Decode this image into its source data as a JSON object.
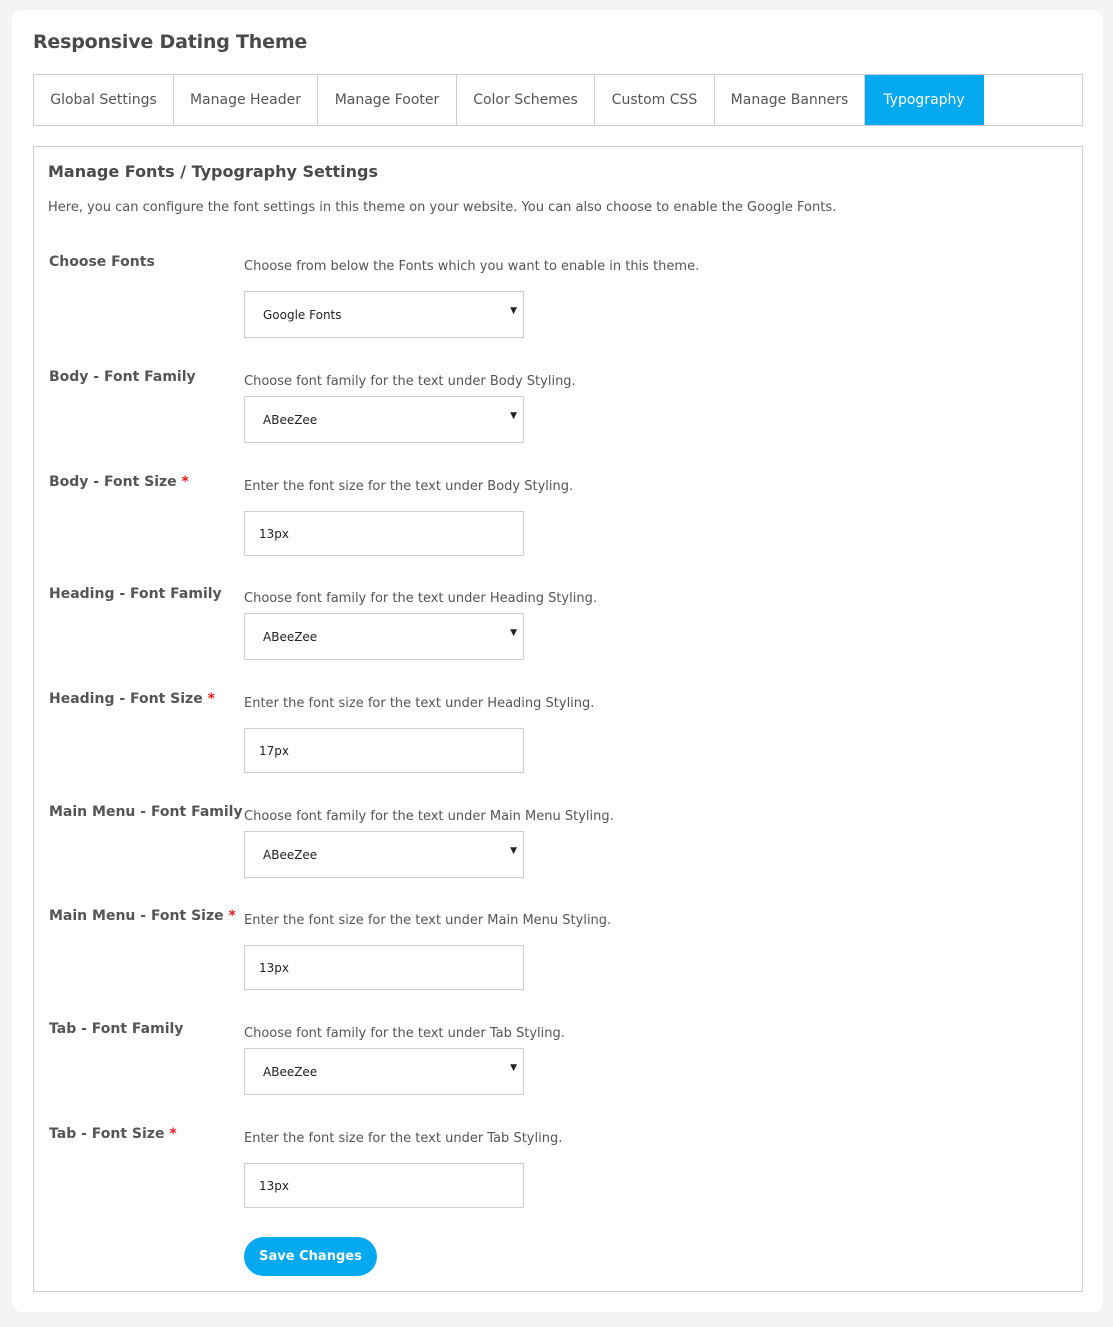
{
  "app": {
    "title": "Responsive Dating Theme"
  },
  "tabs": [
    {
      "label": "Global Settings",
      "active": false
    },
    {
      "label": "Manage Header",
      "active": false
    },
    {
      "label": "Manage Footer",
      "active": false
    },
    {
      "label": "Color Schemes",
      "active": false
    },
    {
      "label": "Custom CSS",
      "active": false
    },
    {
      "label": "Manage Banners",
      "active": false
    },
    {
      "label": "Typography",
      "active": true
    }
  ],
  "panel": {
    "title": "Manage Fonts / Typography Settings",
    "description": "Here, you can configure the font settings in this theme on your website. You can also choose to enable the Google Fonts."
  },
  "fields": [
    {
      "label": "Choose Fonts",
      "required": false,
      "help": "Choose from below the Fonts which you want to enable in this theme.",
      "type": "select",
      "value": "Google Fonts"
    },
    {
      "label": "Body - Font Family",
      "required": false,
      "help": "Choose font family for the text under Body Styling.",
      "type": "select",
      "value": "ABeeZee"
    },
    {
      "label": "Body - Font Size",
      "required": true,
      "help": "Enter the font size for the text under Body Styling.",
      "type": "input",
      "value": "13px"
    },
    {
      "label": "Heading - Font Family",
      "required": false,
      "help": "Choose font family for the text under Heading Styling.",
      "type": "select",
      "value": "ABeeZee"
    },
    {
      "label": "Heading - Font Size",
      "required": true,
      "help": "Enter the font size for the text under Heading Styling.",
      "type": "input",
      "value": "17px"
    },
    {
      "label": "Main Menu - Font Family",
      "required": false,
      "help": "Choose font family for the text under Main Menu Styling.",
      "type": "select",
      "value": "ABeeZee"
    },
    {
      "label": "Main Menu - Font Size",
      "required": true,
      "help": "Enter the font size for the text under Main Menu Styling.",
      "type": "input",
      "value": "13px"
    },
    {
      "label": "Tab - Font Family",
      "required": false,
      "help": "Choose font family for the text under Tab Styling.",
      "type": "select",
      "value": "ABeeZee"
    },
    {
      "label": "Tab - Font Size",
      "required": true,
      "help": "Enter the font size for the text under Tab Styling.",
      "type": "input",
      "value": "13px"
    }
  ],
  "required_marker": "*",
  "caret_glyph": "▼",
  "save_button": {
    "label": "Save Changes"
  },
  "colors": {
    "accent": "#05a9f0",
    "required": "#e41b1b",
    "border": "#cfcfcf"
  }
}
